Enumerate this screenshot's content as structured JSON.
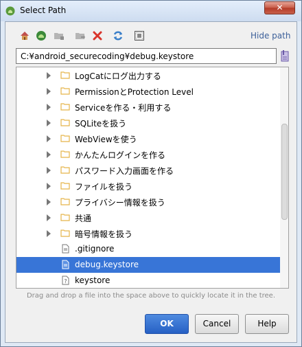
{
  "window": {
    "title": "Select Path",
    "close_glyph": "✕"
  },
  "toolbar": {
    "icons": [
      "home-icon",
      "android-icon",
      "new-folder-icon",
      "move-icon",
      "delete-icon",
      "refresh-icon",
      "show-hidden-icon"
    ],
    "hide_path_label": "Hide path"
  },
  "path": {
    "value": "C:¥android_securecoding¥debug.keystore"
  },
  "tree": {
    "items": [
      {
        "label": "LogCatにログ出力する",
        "type": "folder"
      },
      {
        "label": "PermissionとProtection Level",
        "type": "folder"
      },
      {
        "label": "Serviceを作る・利用する",
        "type": "folder"
      },
      {
        "label": "SQLiteを扱う",
        "type": "folder"
      },
      {
        "label": "WebViewを使う",
        "type": "folder"
      },
      {
        "label": "かんたんログインを作る",
        "type": "folder"
      },
      {
        "label": "パスワード入力画面を作る",
        "type": "folder"
      },
      {
        "label": "ファイルを扱う",
        "type": "folder"
      },
      {
        "label": "プライバシー情報を扱う",
        "type": "folder"
      },
      {
        "label": "共通",
        "type": "folder"
      },
      {
        "label": "暗号情報を扱う",
        "type": "folder"
      },
      {
        "label": ".gitignore",
        "type": "file"
      },
      {
        "label": "debug.keystore",
        "type": "file",
        "selected": true
      },
      {
        "label": "keystore",
        "type": "unknown-file"
      }
    ]
  },
  "hint": "Drag and drop a file into the space above to quickly locate it in the tree.",
  "buttons": {
    "ok": "OK",
    "cancel": "Cancel",
    "help": "Help"
  },
  "colors": {
    "selection": "#3875d7",
    "folder": "#e5b449",
    "link": "#3b5f99"
  }
}
